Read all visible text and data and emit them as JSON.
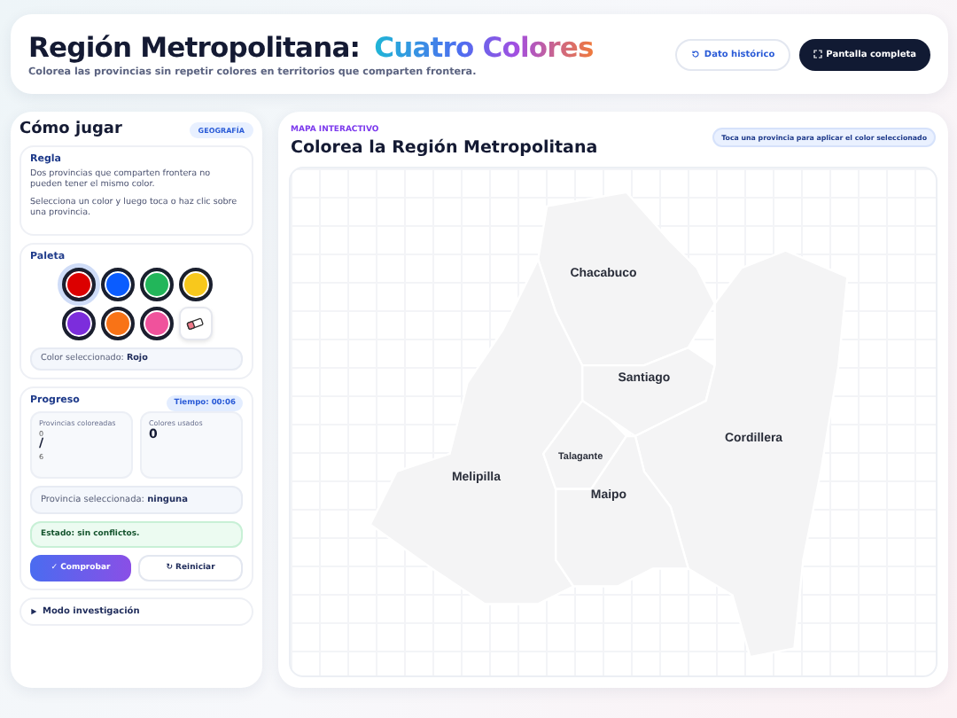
{
  "header": {
    "title": "Región Metropolitana:",
    "title_highlight": "Cuatro Colores",
    "subtitle": "Colorea las provincias sin repetir colores en territorios que comparten frontera.",
    "buttons": [
      {
        "label": "Dato histórico",
        "kind": "secondary"
      },
      {
        "label": "Pantalla completa",
        "kind": "primary"
      }
    ]
  },
  "how_to": {
    "title": "Cómo jugar",
    "badge": "GEOGRAFÍA",
    "rule": {
      "title": "Regla",
      "paragraphs": [
        "Dos provincias que comparten frontera no pueden tener el mismo color.",
        "Selecciona un color y luego toca o haz clic sobre una provincia."
      ]
    },
    "palette": {
      "title": "Paleta",
      "swatches": [
        {
          "kind": "color",
          "color": "#dc0000",
          "selected": true
        },
        {
          "kind": "color",
          "color": "#0a5cff",
          "selected": false
        },
        {
          "kind": "color",
          "color": "#22b65a",
          "selected": false
        },
        {
          "kind": "color",
          "color": "#f8c81c",
          "selected": false
        },
        {
          "kind": "color",
          "color": "#7c2ddc",
          "selected": false
        },
        {
          "kind": "color",
          "color": "#f97316",
          "selected": false
        },
        {
          "kind": "color",
          "color": "#f0529c",
          "selected": false
        },
        {
          "kind": "eraser",
          "selected": false
        }
      ],
      "selected_label": "Color seleccionado:",
      "selected_value": "Rojo"
    },
    "progress": {
      "title": "Progreso",
      "timer": "Tiempo: 00:06",
      "stats": [
        {
          "label": "Provincias coloreadas",
          "value": "0",
          "separator": "/",
          "total": "6"
        },
        {
          "label": "Colores usados",
          "value": "0"
        }
      ],
      "selected_province_label": "Provincia seleccionada:",
      "selected_province_value": "ninguna",
      "status": "Estado: sin conflictos.",
      "buttons": [
        {
          "label": "✓ Comprobar",
          "kind": "primary"
        },
        {
          "label": "↻ Reiniciar",
          "kind": "secondary"
        }
      ]
    },
    "investigation": {
      "label": "Modo investigación",
      "expanded": false
    }
  },
  "map": {
    "eyebrow": "MAPA INTERACTIVO",
    "title": "Colorea la Región Metropolitana",
    "hint": "Toca una provincia para aplicar el color seleccionado",
    "provinces": [
      {
        "name": "Chacabuco",
        "selected": false
      },
      {
        "name": "Santiago",
        "selected": false
      },
      {
        "name": "Cordillera",
        "selected": false
      },
      {
        "name": "Melipilla",
        "selected": false
      },
      {
        "name": "Talagante",
        "selected": false
      },
      {
        "name": "Maipo",
        "selected": false
      }
    ]
  }
}
